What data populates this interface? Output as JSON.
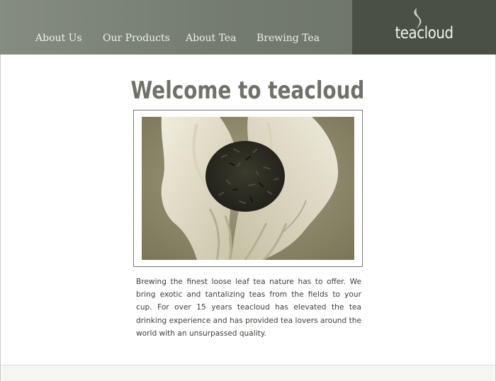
{
  "nav": {
    "items": [
      {
        "label": "About Us"
      },
      {
        "label": "Our Products"
      },
      {
        "label": "About Tea"
      },
      {
        "label": "Brewing Tea"
      }
    ]
  },
  "brand": {
    "name": "teacloud",
    "icon": "steam-wisp-icon"
  },
  "main": {
    "title": "Welcome to teacloud",
    "photo_subject": "cupped-hands-holding-loose-leaf-tea",
    "intro": "Brewing the finest loose leaf tea nature has to offer. We bring exotic and tantalizing teas from the fields to your cup.  For over 15 years teacloud has elevated the tea drinking experience and has provided tea lovers around the world with an unsurpassed quality."
  },
  "colors": {
    "header": "#747b71",
    "brand_block": "#4a5046",
    "title": "#6e7269",
    "photo_tone": "#8a8468"
  }
}
